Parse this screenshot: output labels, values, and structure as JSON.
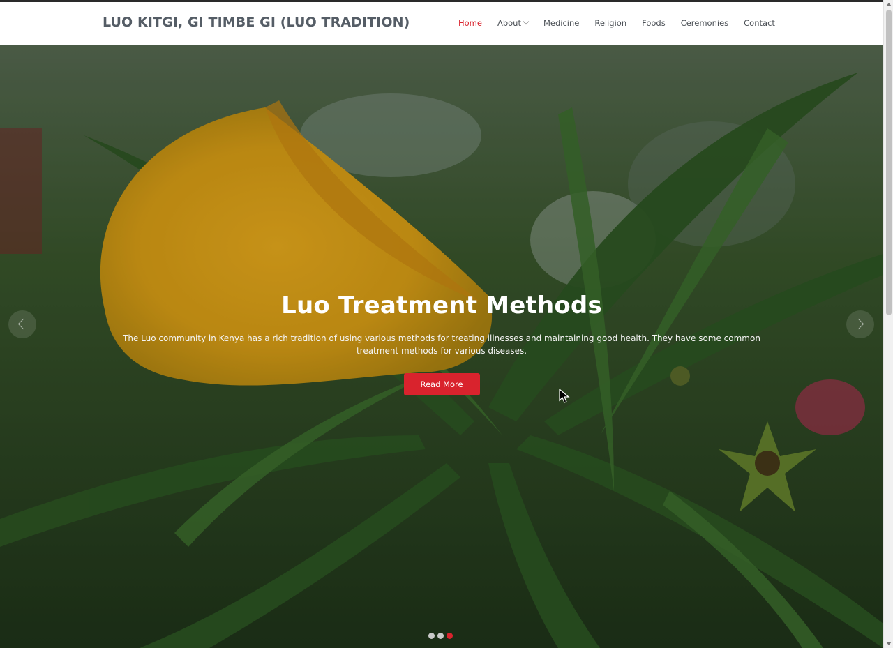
{
  "site": {
    "title": "LUO KITGI, GI TIMBE GI (LUO TRADITION)"
  },
  "nav": {
    "items": [
      {
        "label": "Home",
        "active": true
      },
      {
        "label": "About",
        "has_dropdown": true
      },
      {
        "label": "Medicine"
      },
      {
        "label": "Religion"
      },
      {
        "label": "Foods"
      },
      {
        "label": "Ceremonies"
      },
      {
        "label": "Contact"
      }
    ]
  },
  "hero": {
    "heading": "Luo Treatment Methods",
    "description": "The Luo community in Kenya has a rich tradition of using various methods for treating illnesses and maintaining good health. They have some common treatment methods for various diseases.",
    "button_label": "Read More",
    "slide_count": 3,
    "active_slide": 3
  },
  "colors": {
    "accent": "#d9232d",
    "nav_text": "#4a4f55",
    "logo_text": "#555d66"
  },
  "icons": {
    "prev": "chevron-left-icon",
    "next": "chevron-right-icon",
    "dropdown": "chevron-down-icon"
  }
}
